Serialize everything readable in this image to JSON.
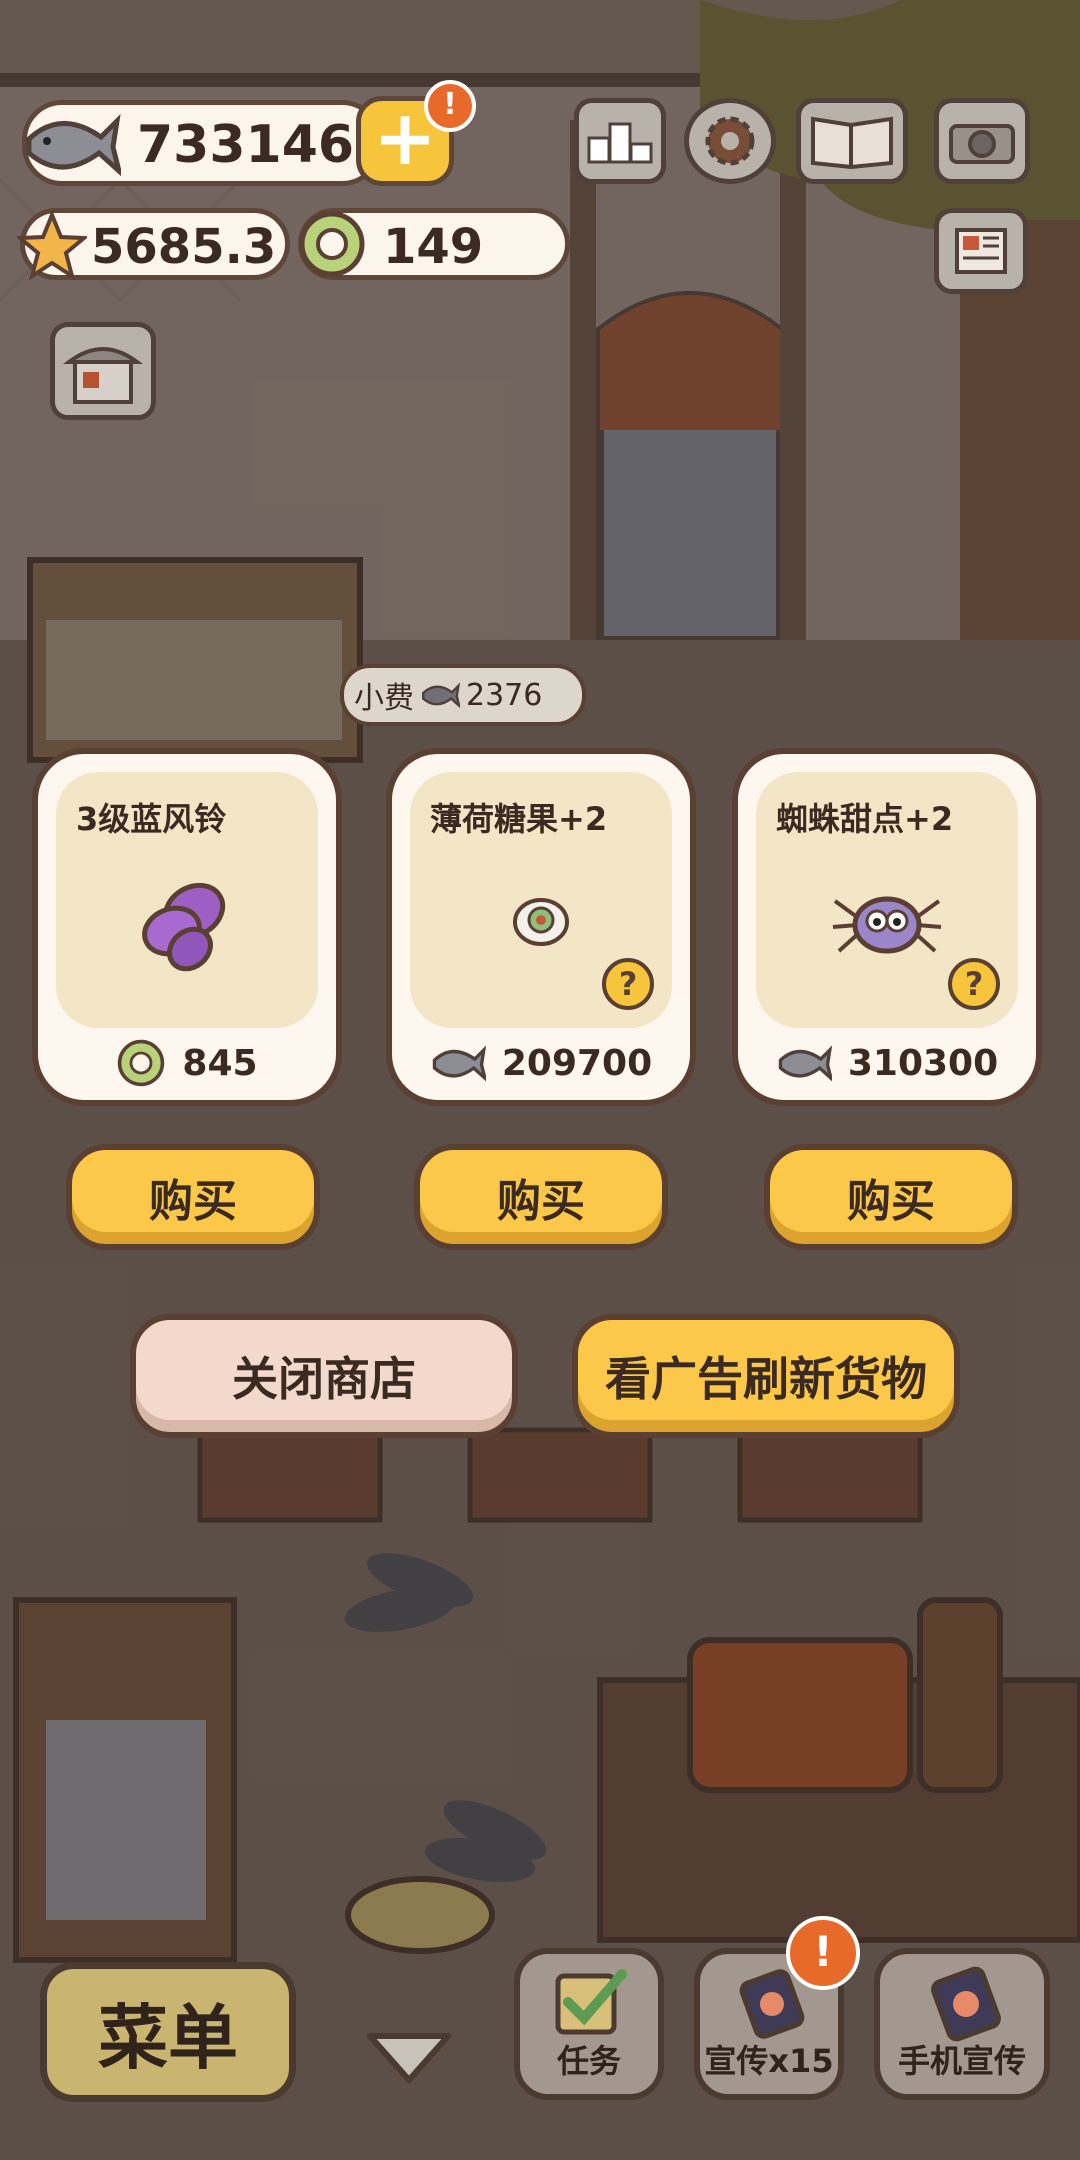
{
  "resources": {
    "fish": "733146",
    "stars": "5685.3",
    "rings": "149"
  },
  "tip": {
    "label": "小费",
    "amount": "2376"
  },
  "shop": {
    "items": [
      {
        "title": "3级蓝风铃",
        "icon": "bluebell-flower-icon",
        "currency": "ring-coin-icon",
        "price": "845",
        "has_help": false
      },
      {
        "title": "薄荷糖果+2",
        "icon": "mint-candy-icon",
        "currency": "fish-coin-icon",
        "price": "209700",
        "has_help": true
      },
      {
        "title": "蜘蛛甜点+2",
        "icon": "spider-dessert-icon",
        "currency": "fish-coin-icon",
        "price": "310300",
        "has_help": true
      }
    ],
    "buy_label": "购买",
    "close_label": "关闭商店",
    "ad_refresh_label": "看广告刷新货物",
    "help_mark": "?"
  },
  "bottom_bar": {
    "menu_label": "菜单",
    "tasks_label": "任务",
    "promote_label": "宣传x15",
    "phone_promote_label": "手机宣传"
  },
  "alert_mark": "!",
  "colors": {
    "accent_yellow": "#fbc849",
    "outline": "#5a3f33",
    "card_bg": "#fdf7ef",
    "alert": "#e86a2b"
  }
}
